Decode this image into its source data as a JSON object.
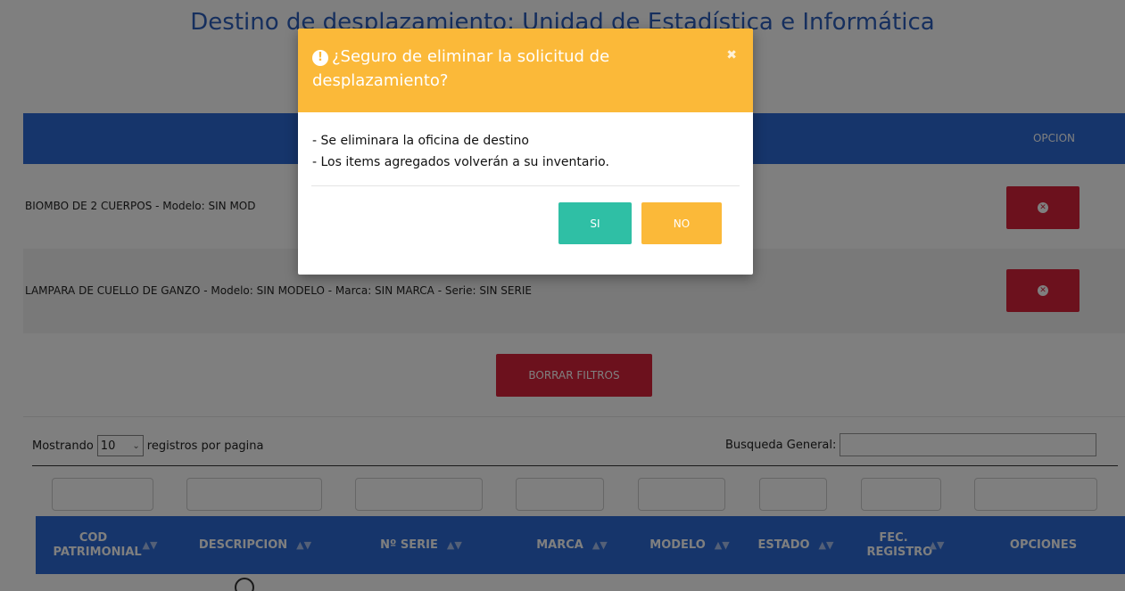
{
  "page": {
    "title": "Destino de desplazamiento: Unidad de Estadística e Informática"
  },
  "selected_items": {
    "header_option": "OPCION",
    "rows": [
      {
        "text": "BIOMBO DE 2 CUERPOS - Modelo: SIN MOD"
      },
      {
        "text": "LAMPARA DE CUELLO DE GANZO - Modelo: SIN MODELO - Marca: SIN MARCA - Serie: SIN SERIE"
      }
    ],
    "delete_icon": "times-circle-icon"
  },
  "filters": {
    "clear_label": "BORRAR FILTROS"
  },
  "table_controls": {
    "showing_prefix": "Mostrando",
    "page_size": "10",
    "showing_suffix": "registros por pagina",
    "search_label": "Busqueda General:",
    "search_value": ""
  },
  "table": {
    "columns": [
      "COD PATRIMONIAL",
      "DESCRIPCION",
      "Nº SERIE",
      "MARCA",
      "MODELO",
      "ESTADO",
      "FEC. REGISTRO",
      "OPCIONES"
    ],
    "sort_icon": "sort-icon"
  },
  "modal": {
    "icon": "exclamation-circle-icon",
    "title": "¿Seguro de eliminar la solicitud de desplazamiento?",
    "lines": [
      "- Se eliminara la oficina de destino",
      "- Los items agregados volverán a su inventario."
    ],
    "yes_label": "SI",
    "no_label": "NO",
    "close_icon": "close-icon"
  },
  "colors": {
    "primary_blue": "#2d6bd6",
    "danger_red": "#d9233a",
    "warning_orange": "#fbb939",
    "success_teal": "#2fbfa5"
  }
}
